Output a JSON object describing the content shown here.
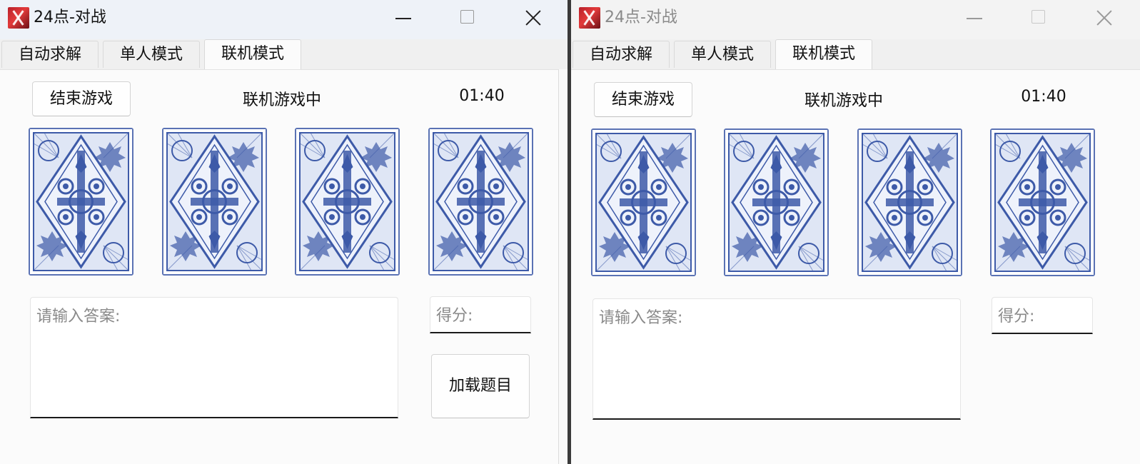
{
  "windows": [
    {
      "title": "24点-对战",
      "tabs": [
        {
          "label": "自动求解"
        },
        {
          "label": "单人模式"
        },
        {
          "label": "联机模式"
        }
      ],
      "active_tab": "联机模式",
      "end_button": "结束游戏",
      "status": "联机游戏中",
      "timer": "01:40",
      "cards": [
        "card-back",
        "card-back",
        "card-back",
        "card-back"
      ],
      "answer_placeholder": "请输入答案:",
      "score_placeholder": "得分:",
      "load_button": "加载题目"
    },
    {
      "title": "24点-对战",
      "tabs": [
        {
          "label": "自动求解"
        },
        {
          "label": "单人模式"
        },
        {
          "label": "联机模式"
        }
      ],
      "active_tab": "联机模式",
      "end_button": "结束游戏",
      "status": "联机游戏中",
      "timer": "01:40",
      "cards": [
        "card-back",
        "card-back",
        "card-back",
        "card-back"
      ],
      "answer_placeholder": "请输入答案:",
      "score_placeholder": "得分:"
    }
  ],
  "colors": {
    "card_blue": "#3d5aa8",
    "card_light": "#dfe6f5",
    "title_inactive": "#8a8a8a"
  }
}
